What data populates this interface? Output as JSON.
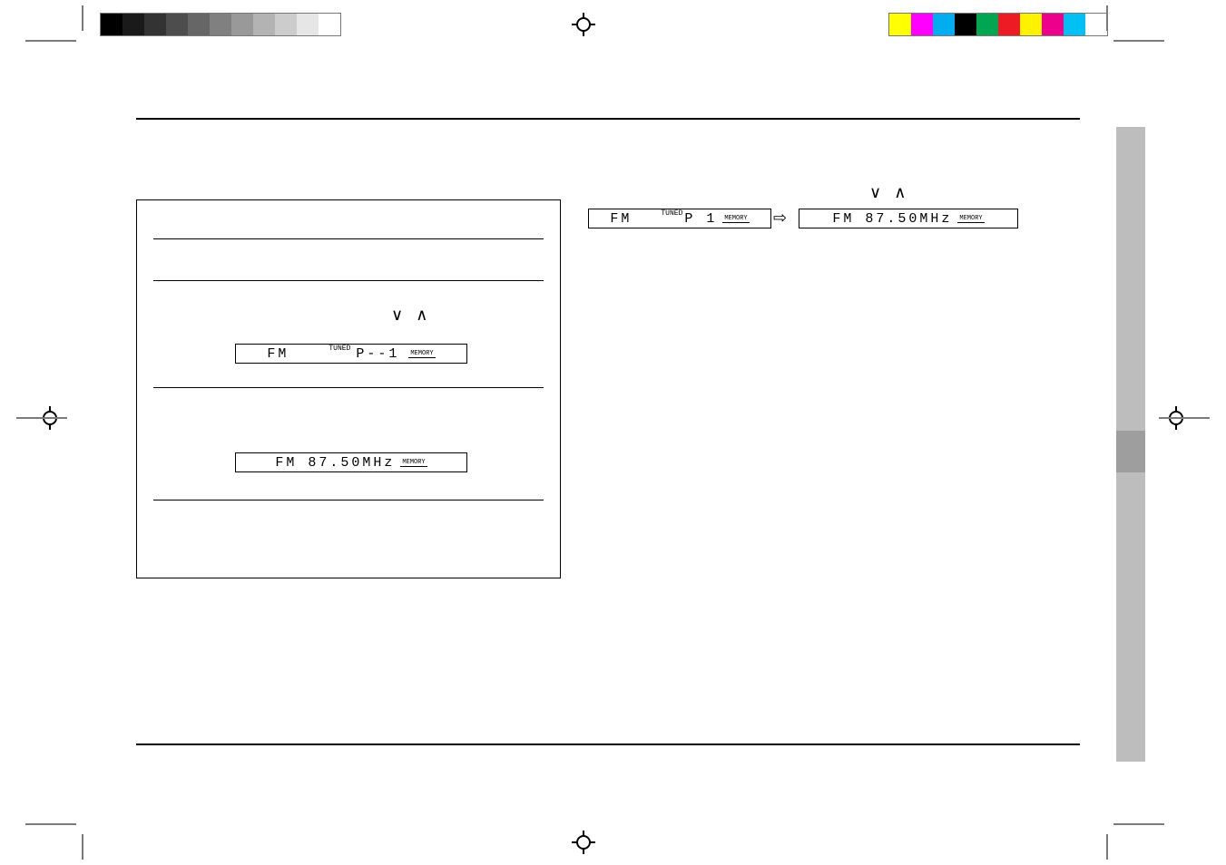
{
  "swatches": {
    "gray": [
      "#000000",
      "#1a1a1a",
      "#333333",
      "#4d4d4d",
      "#666666",
      "#808080",
      "#999999",
      "#b3b3b3",
      "#cccccc",
      "#e6e6e6",
      "#ffffff"
    ],
    "color": [
      "#ffff00",
      "#ff00ff",
      "#00aeef",
      "#000000",
      "#00a651",
      "#ed1c24",
      "#fff200",
      "#ec008c",
      "#00bff3",
      "#ffffff"
    ]
  },
  "steps_box": {
    "lcd_p1_band": "FM",
    "lcd_p1_text": "P--1",
    "lcd_p1_memory_tag": "MEMORY",
    "lcd_freq_text": "FM 87.50MHz",
    "lcd_freq_memory_tag": "MEMORY"
  },
  "right_col": {
    "lcd_recall_band": "FM",
    "lcd_recall_text": "P 1",
    "lcd_recall_memory_tag": "MEMORY",
    "lcd_recall_freq": "FM 87.50MHz",
    "lcd_recall_freq_memory_tag": "MEMORY"
  },
  "glyphs": {
    "chev_down": "∨",
    "chev_up": "∧",
    "arrow_right": "⇨",
    "tuned": "TUNED"
  }
}
